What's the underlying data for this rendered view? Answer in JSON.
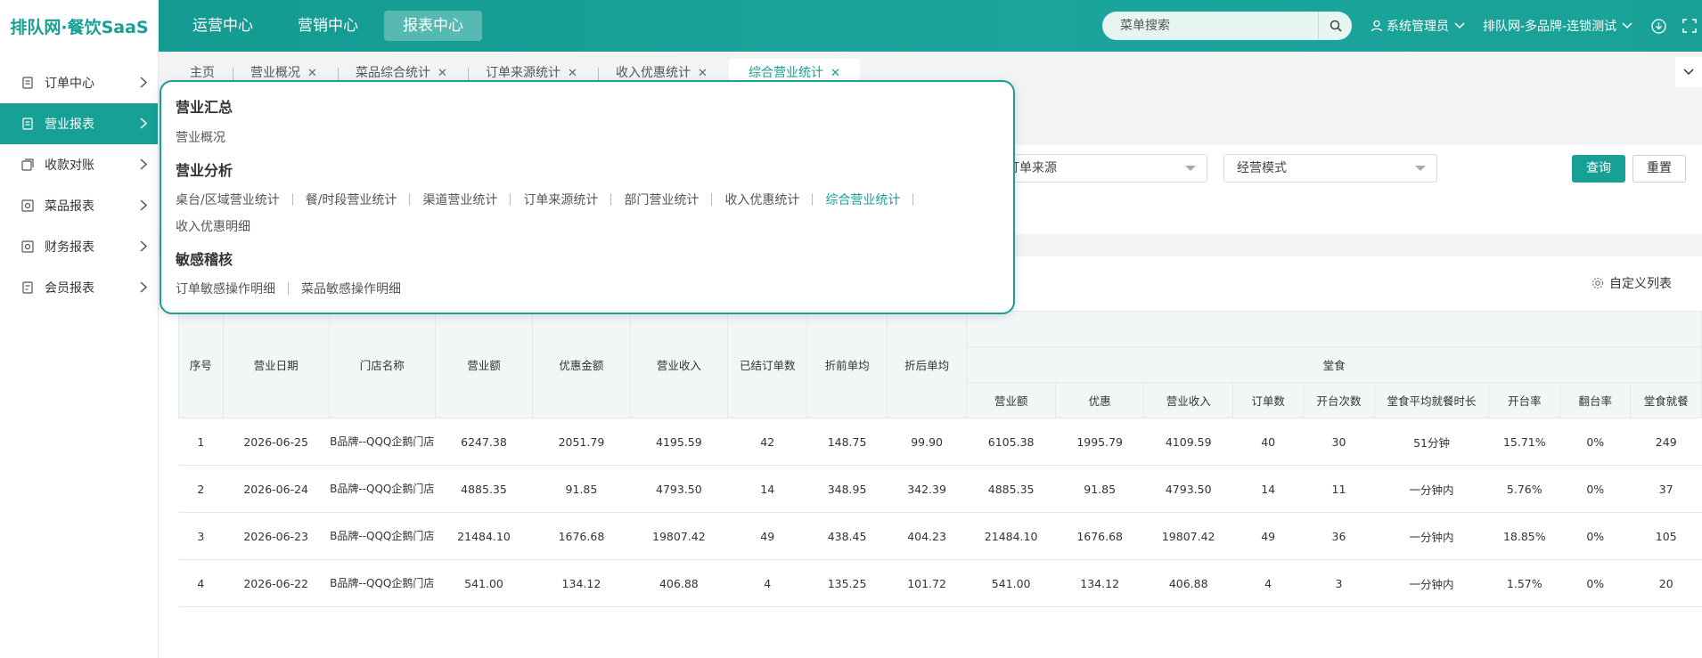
{
  "header": {
    "logo_text": "排队网·餐饮SaaS",
    "nav": [
      "运营中心",
      "营销中心",
      "报表中心"
    ],
    "search_placeholder": "菜单搜索",
    "user": "系统管理员",
    "brand": "排队网-多品牌-连锁测试"
  },
  "sidebar": {
    "items": [
      {
        "label": "订单中心",
        "icon": "order-icon"
      },
      {
        "label": "营业报表",
        "icon": "report-icon"
      },
      {
        "label": "收款对账",
        "icon": "reconcile-icon"
      },
      {
        "label": "菜品报表",
        "icon": "dish-icon"
      },
      {
        "label": "财务报表",
        "icon": "finance-icon"
      },
      {
        "label": "会员报表",
        "icon": "member-icon"
      }
    ],
    "active_index": 1
  },
  "tabs": [
    "主页",
    "营业概况",
    "菜品综合统计",
    "订单来源统计",
    "收入优惠统计",
    "综合营业统计"
  ],
  "filters": {
    "order_source": "订单来源",
    "business_mode": "经营模式",
    "query": "查询",
    "reset": "重置"
  },
  "customize_label": "自定义列表",
  "table": {
    "group_header": "堂食",
    "columns": [
      "序号",
      "营业日期",
      "门店名称",
      "营业额",
      "优惠金额",
      "营业收入",
      "已结订单数",
      "折前单均",
      "折后单均"
    ],
    "sub_columns": [
      "营业额",
      "优惠",
      "营业收入",
      "订单数",
      "开台次数",
      "堂食平均就餐时长",
      "开台率",
      "翻台率",
      "堂食就餐"
    ],
    "rows": [
      [
        "1",
        "2026-06-25",
        "B品牌--QQQ企鹅门店",
        "6247.38",
        "2051.79",
        "4195.59",
        "42",
        "148.75",
        "99.90",
        "6105.38",
        "1995.79",
        "4109.59",
        "40",
        "30",
        "51分钟",
        "15.71%",
        "0%",
        "249"
      ],
      [
        "2",
        "2026-06-24",
        "B品牌--QQQ企鹅门店",
        "4885.35",
        "91.85",
        "4793.50",
        "14",
        "348.95",
        "342.39",
        "4885.35",
        "91.85",
        "4793.50",
        "14",
        "11",
        "一分钟内",
        "5.76%",
        "0%",
        "37"
      ],
      [
        "3",
        "2026-06-23",
        "B品牌--QQQ企鹅门店",
        "21484.10",
        "1676.68",
        "19807.42",
        "49",
        "438.45",
        "404.23",
        "21484.10",
        "1676.68",
        "19807.42",
        "49",
        "36",
        "一分钟内",
        "18.85%",
        "0%",
        "105"
      ],
      [
        "4",
        "2026-06-22",
        "B品牌--QQQ企鹅门店",
        "541.00",
        "134.12",
        "406.88",
        "4",
        "135.25",
        "101.72",
        "541.00",
        "134.12",
        "406.88",
        "4",
        "3",
        "一分钟内",
        "1.57%",
        "0%",
        "20"
      ]
    ]
  },
  "menu": {
    "sections": [
      {
        "title": "营业汇总",
        "links": [
          "营业概况"
        ]
      },
      {
        "title": "营业分析",
        "links": [
          "桌台/区域营业统计",
          "餐/时段营业统计",
          "渠道营业统计",
          "订单来源统计",
          "部门营业统计",
          "收入优惠统计",
          "综合营业统计",
          "收入优惠明细"
        ]
      },
      {
        "title": "敏感稽核",
        "links": [
          "订单敏感操作明细",
          "菜品敏感操作明细"
        ]
      }
    ],
    "current": "综合营业统计"
  },
  "colors": {
    "primary": "#17a096",
    "header_bg": "#17a096"
  }
}
